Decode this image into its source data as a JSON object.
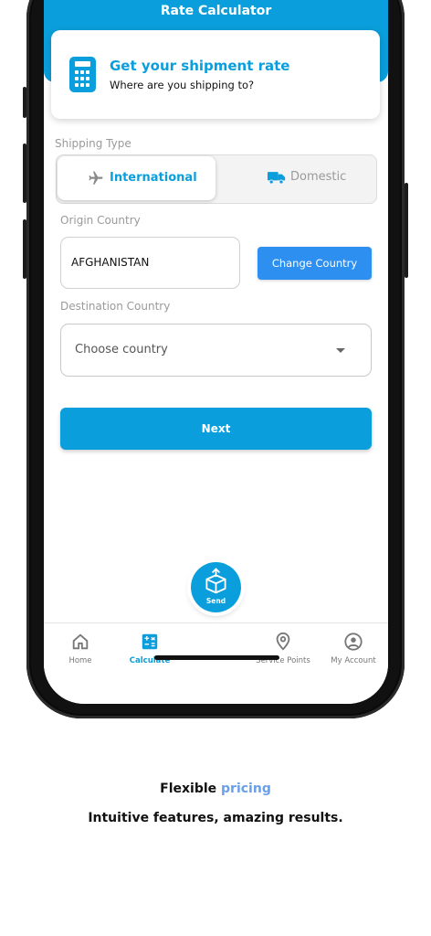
{
  "header": {
    "title": "Rate Calculator"
  },
  "rate_card": {
    "title": "Get your shipment rate",
    "subtitle": "Where are you shipping to?",
    "icon": "calculator-icon"
  },
  "shipping_type": {
    "label": "Shipping Type",
    "options": [
      {
        "label": "International",
        "icon": "airplane-icon",
        "selected": true
      },
      {
        "label": "Domestic",
        "icon": "truck-icon",
        "selected": false
      }
    ]
  },
  "origin": {
    "label": "Origin Country",
    "value": "AFGHANISTAN",
    "change_label": "Change Country"
  },
  "destination": {
    "label": "Destination Country",
    "placeholder": "Choose country"
  },
  "next_label": "Next",
  "bottom_nav": {
    "items": [
      {
        "label": "Home",
        "icon": "home-icon",
        "active": false
      },
      {
        "label": "Calculate",
        "icon": "calculator-icon",
        "active": true
      },
      {
        "label": "Service Points",
        "icon": "location-pin-icon",
        "active": false
      },
      {
        "label": "My Account",
        "icon": "account-icon",
        "active": false
      }
    ],
    "send_label": "Send"
  },
  "footer": {
    "tagline_main": "Flexible",
    "tagline_accent": "pricing",
    "subline": "Intuitive features, amazing results."
  },
  "colors": {
    "primary": "#0a9fdc",
    "button_blue": "#2d8ff0",
    "accent_text": "#6aa0e8"
  }
}
